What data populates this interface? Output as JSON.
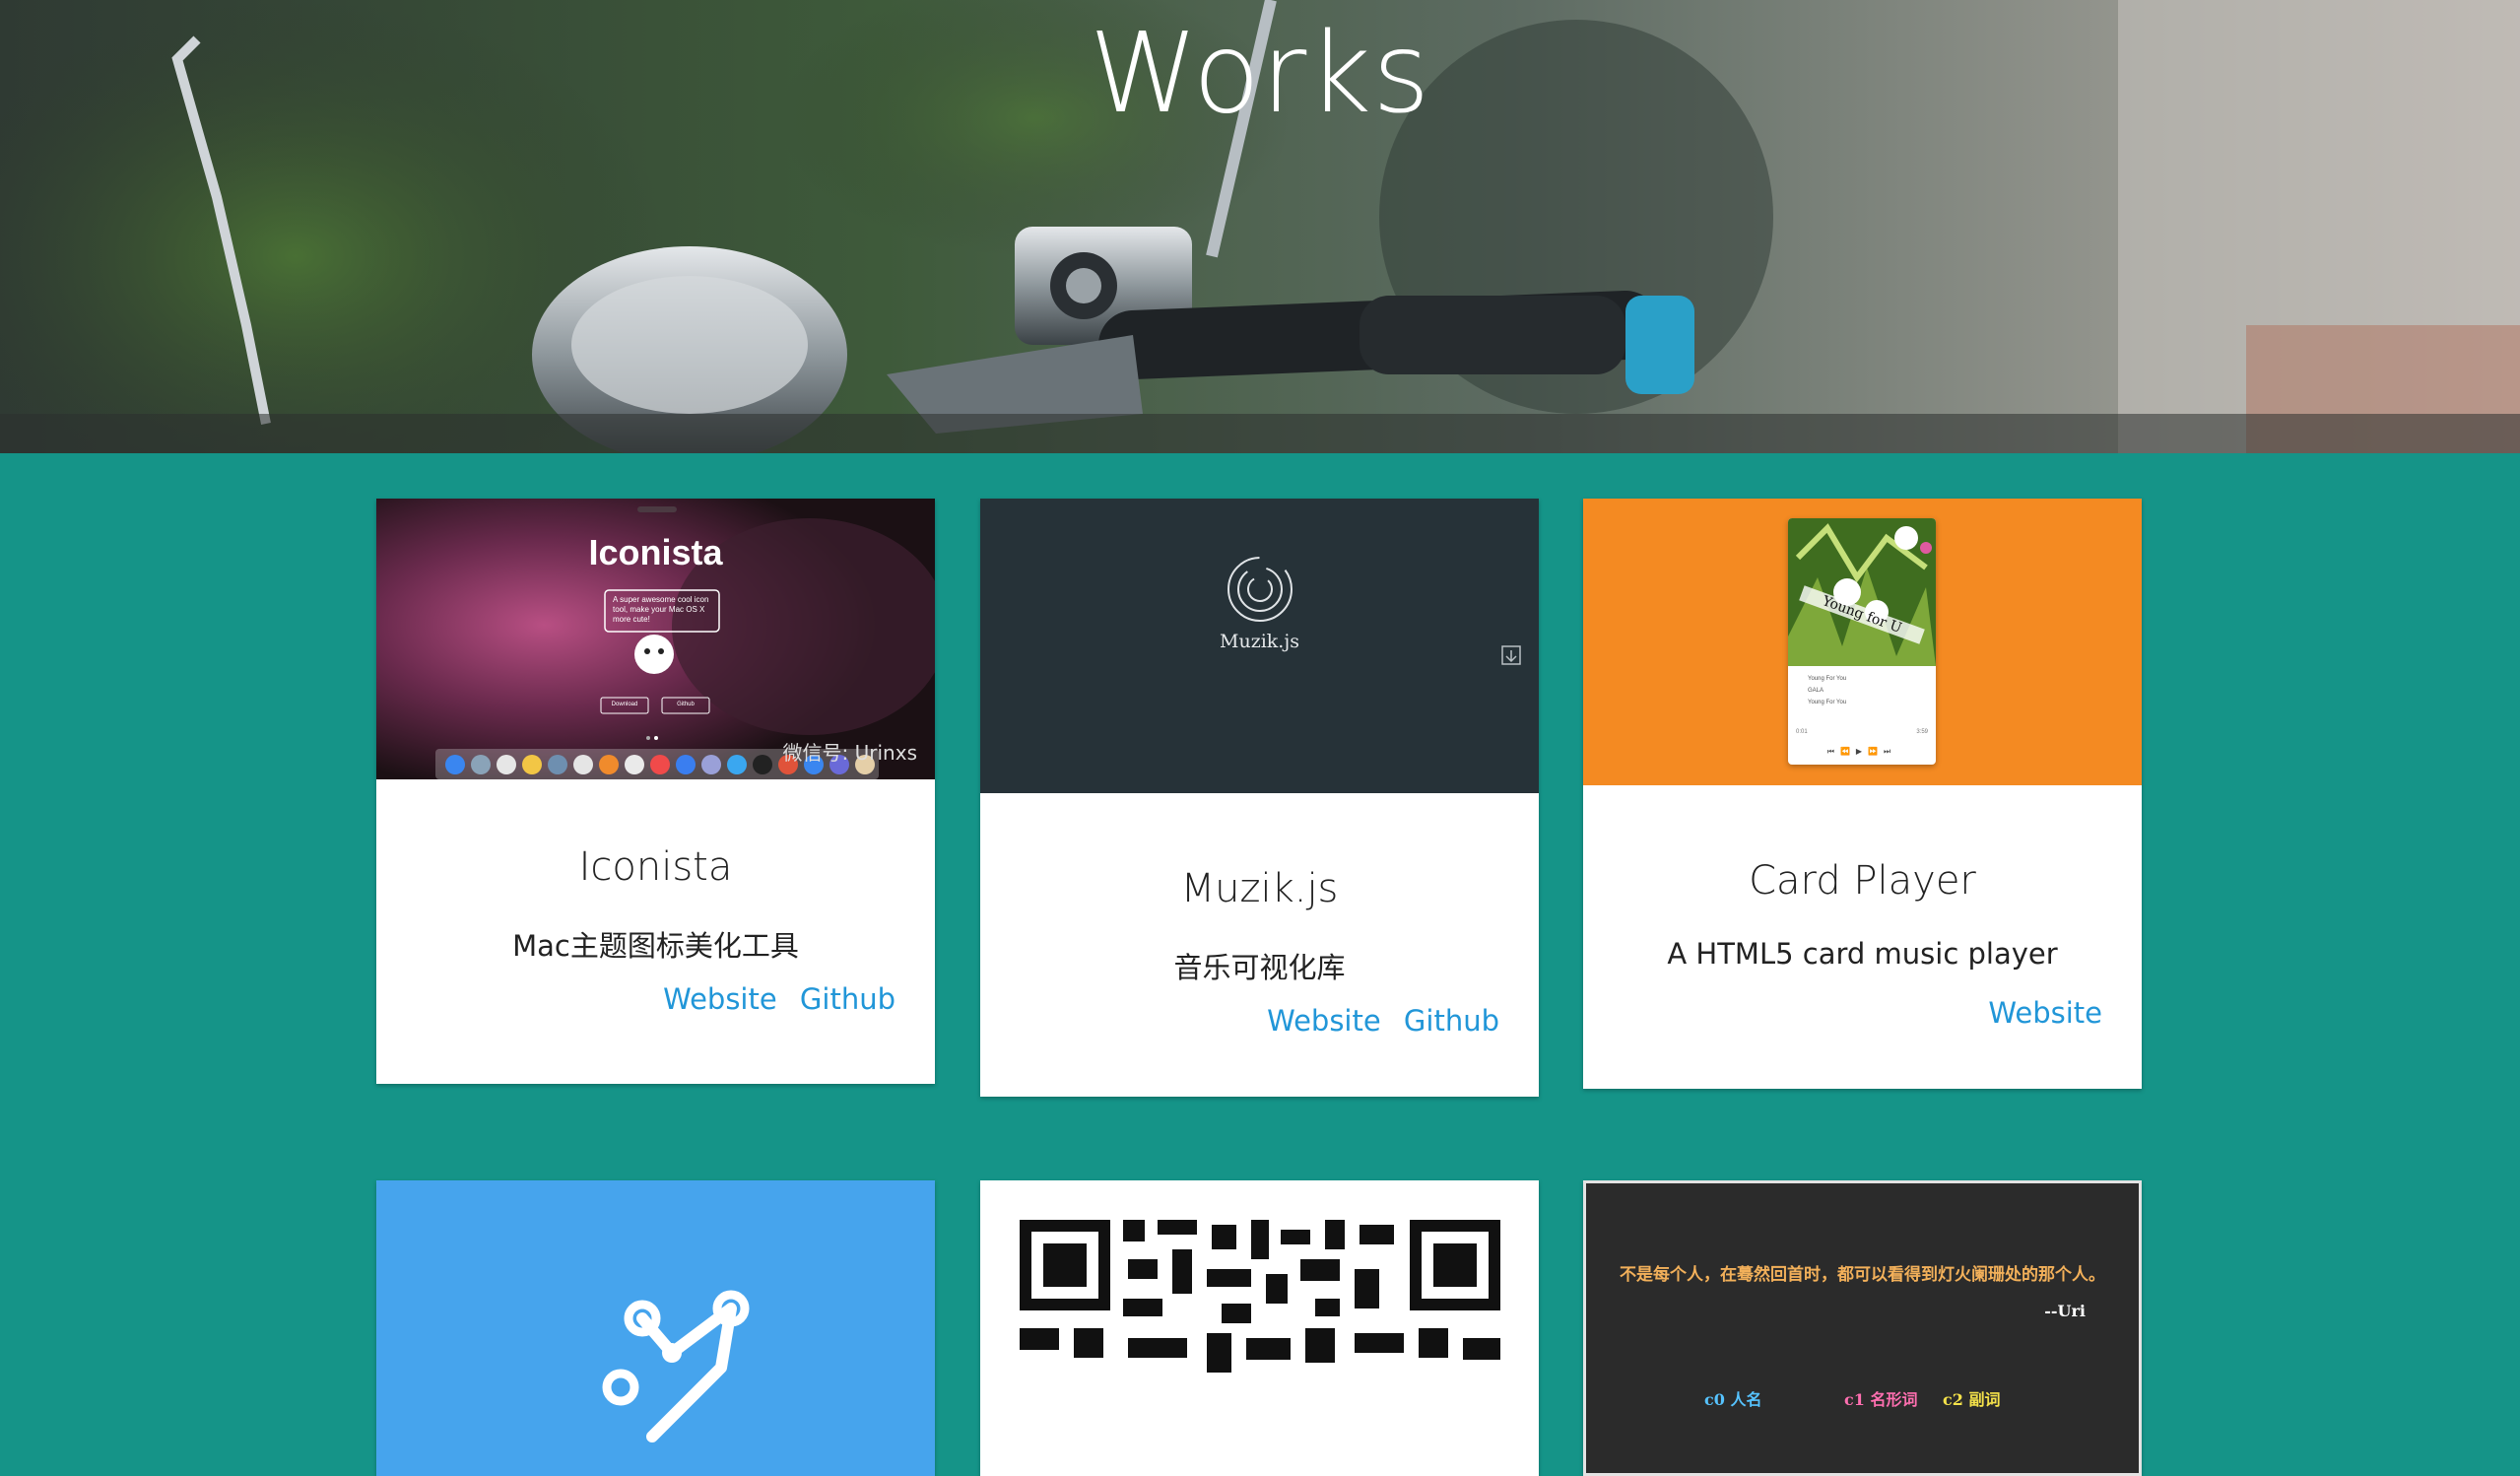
{
  "page": {
    "title": "Works"
  },
  "works": [
    {
      "title": "Iconista",
      "description": "Mac主题图标美化工具",
      "links": [
        "Website",
        "Github"
      ],
      "thumb": {
        "heading": "Iconista",
        "blurb": "A super awesome cool icon tool, make your Mac OS X more cute!",
        "buttons": [
          "Download",
          "Github"
        ],
        "watermark": "微信号: Urinxs"
      }
    },
    {
      "title": "Muzik.js",
      "description": "音乐可视化库",
      "links": [
        "Website",
        "Github"
      ],
      "thumb": {
        "label": "Muzik.js"
      }
    },
    {
      "title": "Card Player",
      "description": "A HTML5 card music player",
      "links": [
        "Website"
      ],
      "thumb": {
        "cover_text": "Young for U",
        "tracks": [
          "Young For You",
          "GALA",
          "Young For You"
        ],
        "time_start": "0:01",
        "time_end": "3:59"
      }
    },
    {
      "title": "",
      "description": "",
      "links": []
    },
    {
      "title": "",
      "description": "",
      "links": []
    },
    {
      "title": "",
      "description": "",
      "links": [],
      "thumb": {
        "quote": "不是每个人，在蓦然回首时，都可以看得到灯火阑珊处的那个人。",
        "author": "--Uri",
        "legend": [
          "c0 人名",
          "c1 名形词",
          "c2 副词"
        ]
      }
    }
  ],
  "colors": {
    "background": "#159488",
    "link": "#2196d8",
    "card_player_bg": "#f48a22",
    "muzik_bg": "#263238",
    "graph_bg": "#46a4ed"
  }
}
